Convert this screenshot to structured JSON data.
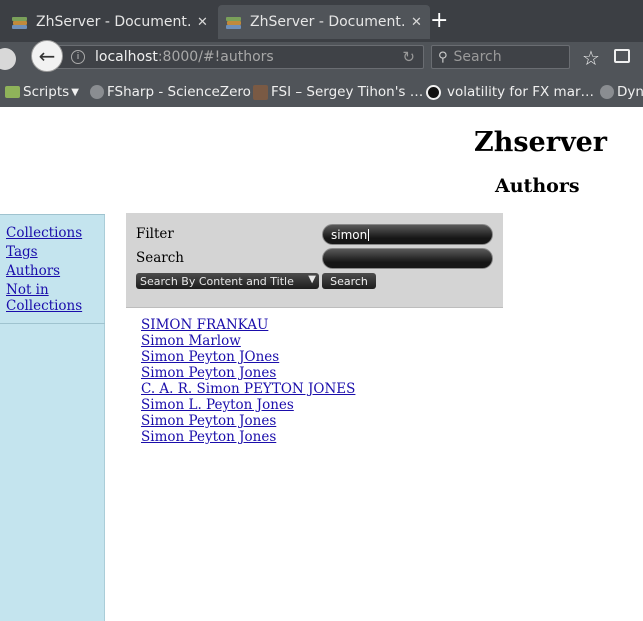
{
  "browser": {
    "tabs": [
      {
        "title": "ZhServer - Document…",
        "close": "✕"
      },
      {
        "title": "ZhServer - Document…",
        "close": "✕"
      }
    ],
    "new_tab": "+",
    "url": {
      "host": "localhost",
      "rest": ":8000/#!authors"
    },
    "search_placeholder": "Search",
    "bookmarks": [
      "Scripts",
      "FSharp - ScienceZero",
      "FSI – Sergey Tihon's …",
      "volatility for FX mar…",
      "Dyn"
    ]
  },
  "page": {
    "site_title": "Zhserver",
    "section_title": "Authors",
    "sidebar": [
      "Collections",
      "Tags",
      "Authors",
      "Not in",
      "Collections"
    ],
    "filter": {
      "filter_label": "Filter",
      "filter_value": "simon",
      "search_label": "Search",
      "search_value": "",
      "mode_select": "Search By Content and Title",
      "search_button": "Search"
    },
    "results": [
      "SIMON FRANKAU",
      "Simon Marlow",
      "Simon Peyton JOnes",
      "Simon Peyton Jones",
      "C. A. R. Simon PEYTON JONES",
      "Simon L. Peyton Jones",
      "Simon Peyton Jones",
      "Simon Peyton Jones"
    ]
  }
}
